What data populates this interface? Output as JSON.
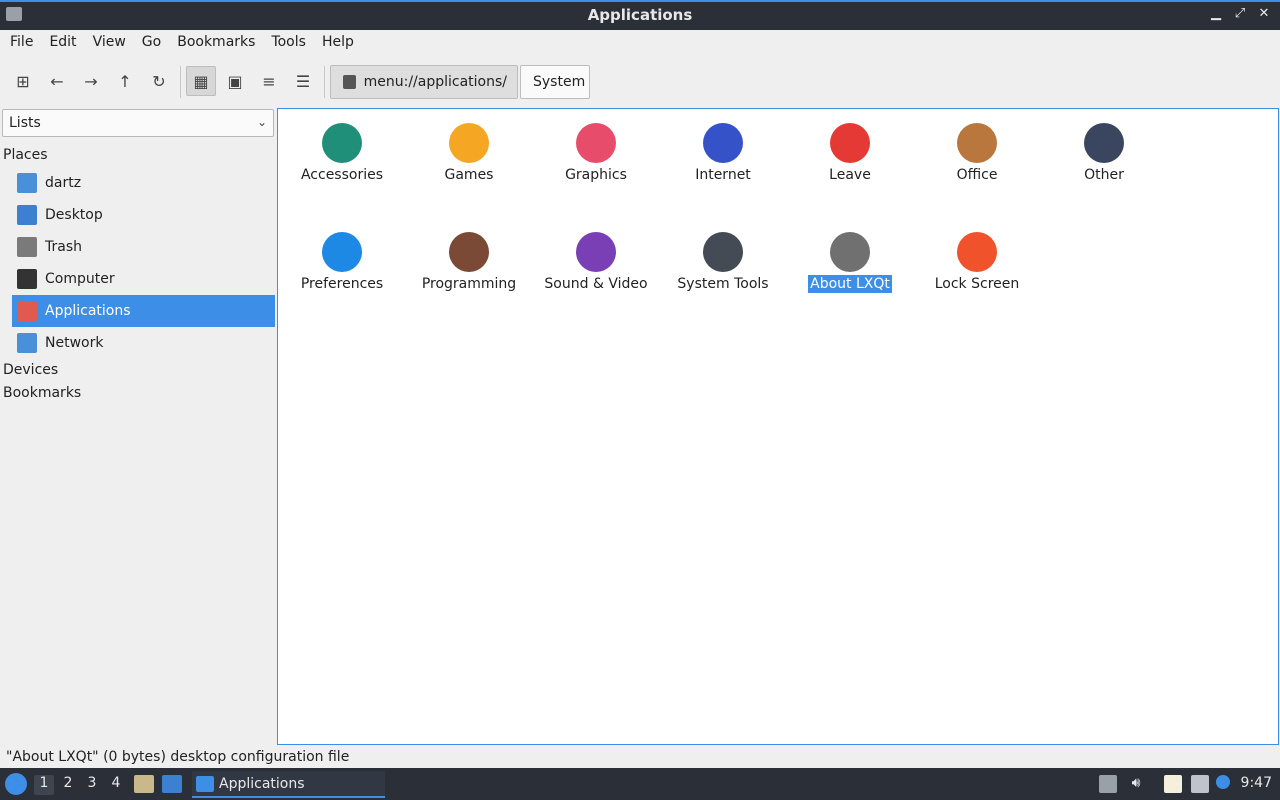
{
  "window": {
    "title": "Applications"
  },
  "window_controls": {
    "minimize": "▁",
    "maximize": "⤢",
    "close": "✕"
  },
  "menu": [
    "File",
    "Edit",
    "View",
    "Go",
    "Bookmarks",
    "Tools",
    "Help"
  ],
  "toolbar": {
    "icons": {
      "new_tab": "⊞",
      "back": "←",
      "forward": "→",
      "up": "↑",
      "reload": "↻",
      "icon_view": "▦",
      "thumbnail_view": "▣",
      "compact_view": "≡",
      "detail_view": "☰"
    },
    "path": {
      "location": "menu://applications/",
      "segment": "System"
    }
  },
  "sidebar": {
    "mode": "Lists",
    "sections": {
      "places": "Places",
      "devices": "Devices",
      "bookmarks": "Bookmarks"
    },
    "places": [
      {
        "label": "dartz",
        "icon": "home-folder-icon",
        "color": "#4a90d9"
      },
      {
        "label": "Desktop",
        "icon": "desktop-icon",
        "color": "#3d7fd0"
      },
      {
        "label": "Trash",
        "icon": "trash-icon",
        "color": "#7a7a7a"
      },
      {
        "label": "Computer",
        "icon": "computer-icon",
        "color": "#333333"
      },
      {
        "label": "Applications",
        "icon": "applications-icon",
        "color": "#e05a4f",
        "selected": true
      },
      {
        "label": "Network",
        "icon": "network-folder-icon",
        "color": "#4a90d9"
      }
    ]
  },
  "main": {
    "items": [
      {
        "label": "Accessories",
        "icon": "accessories-icon",
        "color": "#1f8f7a"
      },
      {
        "label": "Games",
        "icon": "games-icon",
        "color": "#f5a623"
      },
      {
        "label": "Graphics",
        "icon": "graphics-icon",
        "color": "#e84c6b"
      },
      {
        "label": "Internet",
        "icon": "internet-icon",
        "color": "#3552c9"
      },
      {
        "label": "Leave",
        "icon": "power-icon",
        "color": "#e53935"
      },
      {
        "label": "Office",
        "icon": "office-icon",
        "color": "#b9773d"
      },
      {
        "label": "Other",
        "icon": "other-icon",
        "color": "#3a4660"
      },
      {
        "label": "Preferences",
        "icon": "preferences-icon",
        "color": "#1e88e5"
      },
      {
        "label": "Programming",
        "icon": "programming-icon",
        "color": "#7b4a37"
      },
      {
        "label": "Sound & Video",
        "icon": "sound-video-icon",
        "color": "#7b3fb5"
      },
      {
        "label": "System Tools",
        "icon": "system-tools-icon",
        "color": "#444b55"
      },
      {
        "label": "About LXQt",
        "icon": "info-icon",
        "color": "#707070",
        "selected": true
      },
      {
        "label": "Lock Screen",
        "icon": "lock-icon",
        "color": "#f0522c"
      }
    ]
  },
  "status": "\"About LXQt\" (0 bytes) desktop configuration file",
  "taskbar": {
    "desktops": [
      "1",
      "2",
      "3",
      "4"
    ],
    "active_desktop": "1",
    "task_label": "Applications",
    "clock": "9:47"
  },
  "colors": {
    "accent": "#3d8ee6",
    "titlebar": "#2b3038"
  }
}
